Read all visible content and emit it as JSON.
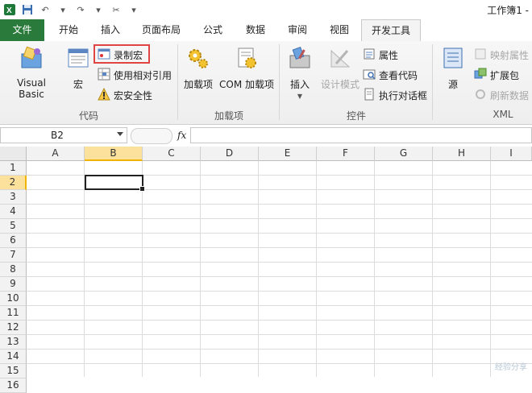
{
  "quick_access": {
    "icons": [
      "excel-logo-icon",
      "save-icon",
      "undo-icon",
      "redo-icon",
      "customize-icon"
    ]
  },
  "window_title": "工作簿1 -",
  "tabs": [
    "文件",
    "开始",
    "插入",
    "页面布局",
    "公式",
    "数据",
    "审阅",
    "视图",
    "开发工具"
  ],
  "active_tab": "开发工具",
  "ribbon": {
    "code": {
      "label": "代码",
      "visual_basic": "Visual Basic",
      "macros": "宏",
      "record_macro": "录制宏",
      "relative_ref": "使用相对引用",
      "macro_security": "宏安全性"
    },
    "addins": {
      "label": "加载项",
      "addins": "加载项",
      "com_addins": "COM 加载项"
    },
    "controls": {
      "label": "控件",
      "insert": "插入",
      "design_mode": "设计模式",
      "properties": "属性",
      "view_code": "查看代码",
      "run_dialog": "执行对话框"
    },
    "xml": {
      "label": "XML",
      "source": "源",
      "map_properties": "映射属性",
      "expansion_packs": "扩展包",
      "refresh_data": "刷新数据"
    }
  },
  "formula_bar": {
    "name_box": "B2",
    "fx": "fx",
    "value": ""
  },
  "sheet": {
    "columns": [
      "A",
      "B",
      "C",
      "D",
      "E",
      "F",
      "G",
      "H",
      "I"
    ],
    "rows": [
      "1",
      "2",
      "3",
      "4",
      "5",
      "6",
      "7",
      "8",
      "9",
      "10",
      "11",
      "12",
      "13",
      "14",
      "15",
      "16"
    ],
    "selected_col": "B",
    "selected_row": "2"
  },
  "watermark": "经验分享"
}
